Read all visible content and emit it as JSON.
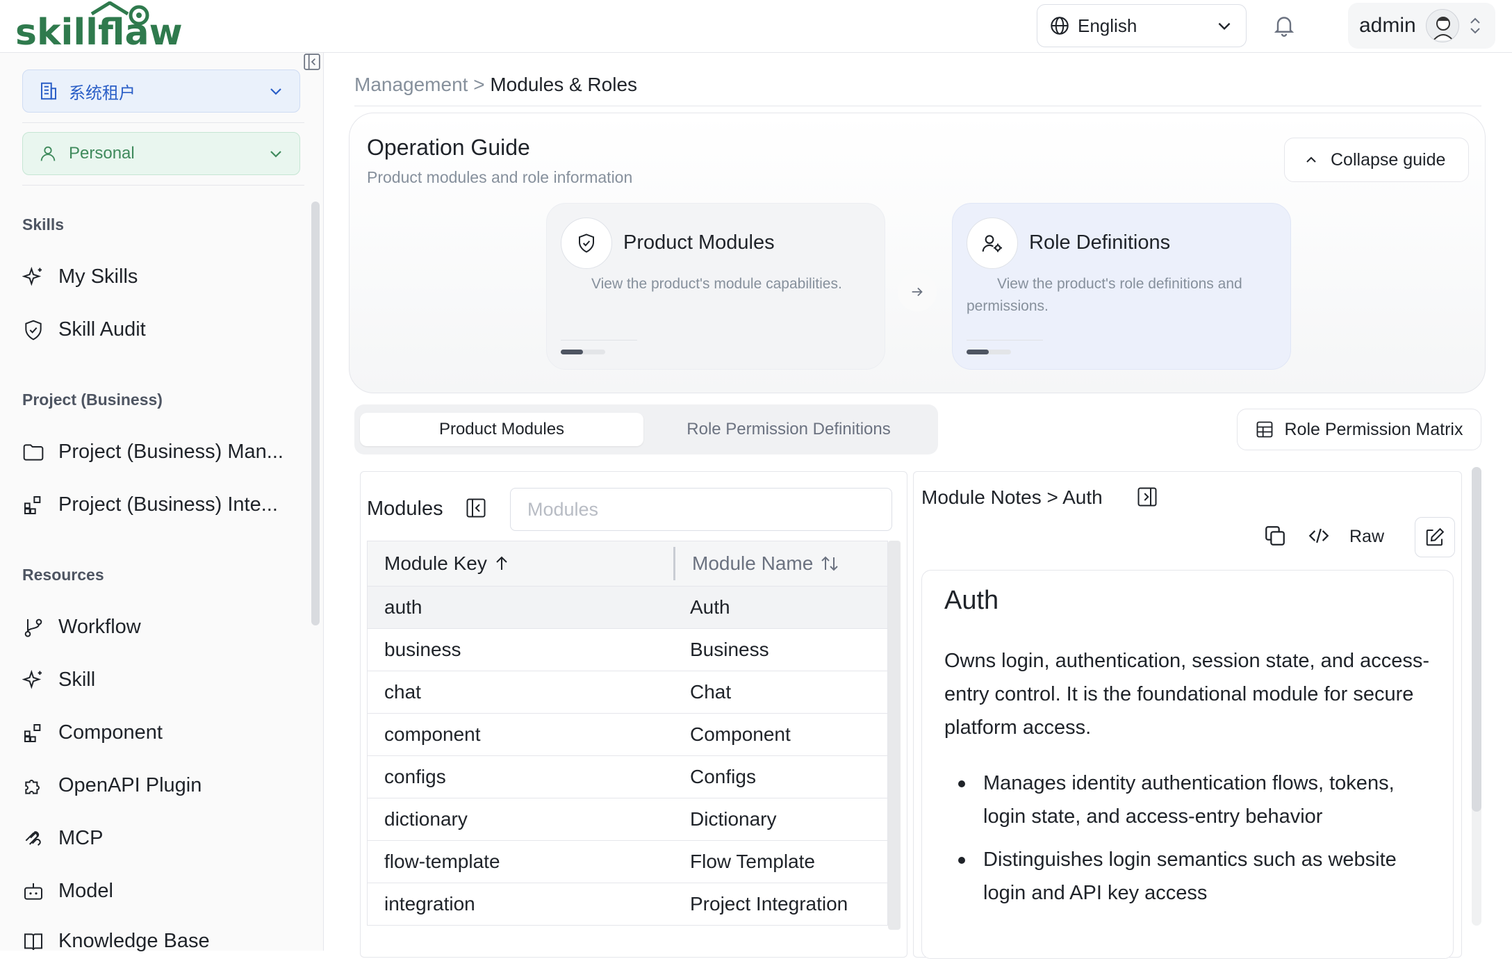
{
  "app": {
    "logo_text": "skillflaw"
  },
  "header": {
    "language": "English",
    "user": "admin"
  },
  "sidebar": {
    "tenant": "系统租户",
    "workspace": "Personal",
    "sections": {
      "skills": "Skills",
      "project": "Project (Business)",
      "resources": "Resources"
    },
    "skills_items": [
      "My Skills",
      "Skill Audit"
    ],
    "project_items": [
      "Project (Business) Man...",
      "Project (Business) Inte..."
    ],
    "resource_items": [
      "Workflow",
      "Skill",
      "Component",
      "OpenAPI Plugin",
      "MCP",
      "Model",
      "Knowledge Base"
    ]
  },
  "breadcrumb": {
    "parent": "Management",
    "sep": ">",
    "current": "Modules & Roles"
  },
  "guide": {
    "title": "Operation Guide",
    "subtitle": "Product modules and role information",
    "collapse_label": "Collapse guide",
    "cards": [
      {
        "title": "Product Modules",
        "desc": "View the product's module capabilities."
      },
      {
        "title": "Role Definitions",
        "desc": "View the product's role definitions and permissions."
      }
    ]
  },
  "tabs": {
    "active": "Product Modules",
    "inactive": "Role Permission Definitions",
    "matrix": "Role Permission Matrix"
  },
  "modules": {
    "title": "Modules",
    "search_placeholder": "Modules",
    "columns": [
      "Module Key",
      "Module Name"
    ],
    "rows": [
      [
        "auth",
        "Auth"
      ],
      [
        "business",
        "Business"
      ],
      [
        "chat",
        "Chat"
      ],
      [
        "component",
        "Component"
      ],
      [
        "configs",
        "Configs"
      ],
      [
        "dictionary",
        "Dictionary"
      ],
      [
        "flow-template",
        "Flow Template"
      ],
      [
        "integration",
        "Project Integration"
      ]
    ],
    "selected_row": 0
  },
  "notes": {
    "title": "Module Notes > Auth",
    "raw_label": "Raw",
    "heading": "Auth",
    "paragraph": "Owns login, authentication, session state, and access-entry control. It is the foundational module for secure platform access.",
    "bullets": [
      "Manages identity authentication flows, tokens, login state, and access-entry behavior",
      "Distinguishes login semantics such as website login and API key access"
    ]
  },
  "colors": {
    "brand_green": "#2f7a4d",
    "tenant_blue": "#2b5fc7",
    "personal_green": "#3f8a5c"
  }
}
